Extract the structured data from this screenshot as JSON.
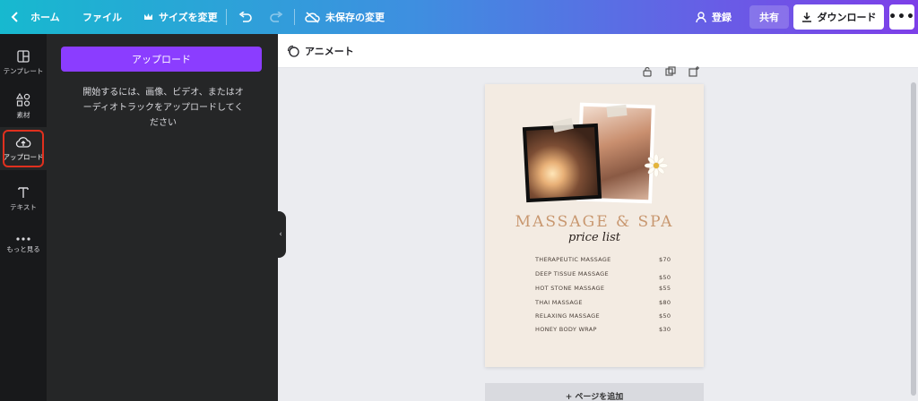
{
  "topbar": {
    "home": "ホーム",
    "file": "ファイル",
    "resize": "サイズを変更",
    "save_status": "未保存の変更",
    "login": "登録",
    "share": "共有",
    "download": "ダウンロード",
    "more": "•••"
  },
  "rail": {
    "items": [
      {
        "label": "テンプレート",
        "icon": "template-icon"
      },
      {
        "label": "素材",
        "icon": "elements-icon"
      },
      {
        "label": "アップロード",
        "icon": "cloud-upload-icon"
      },
      {
        "label": "テキスト",
        "icon": "text-icon"
      },
      {
        "label": "もっと見る",
        "icon": "more-dots-icon"
      }
    ]
  },
  "panel": {
    "upload_button": "アップロード",
    "help_text": "開始するには、画像、ビデオ、またはオーディオトラックをアップロードしてください"
  },
  "subbar": {
    "animate": "アニメート"
  },
  "design": {
    "title": "MASSAGE & SPA",
    "subtitle": "price list",
    "prices": [
      {
        "name": "THERAPEUTIC MASSAGE",
        "price": "$70"
      },
      {
        "name": "DEEP TISSUE MASSAGE",
        "price": "$50"
      },
      {
        "name": "HOT STONE MASSAGE",
        "price": "$55"
      },
      {
        "name": "THAI MASSAGE",
        "price": "$80"
      },
      {
        "name": "RELAXING MASSAGE",
        "price": "$50"
      },
      {
        "name": "HONEY BODY WRAP",
        "price": "$30"
      }
    ]
  },
  "add_page": "+ ページを追加",
  "colors": {
    "accent": "#8b3dff",
    "rail_bg": "#18191b",
    "panel_bg": "#252627",
    "highlight": "#e0301e",
    "title_color": "#c8976f"
  }
}
